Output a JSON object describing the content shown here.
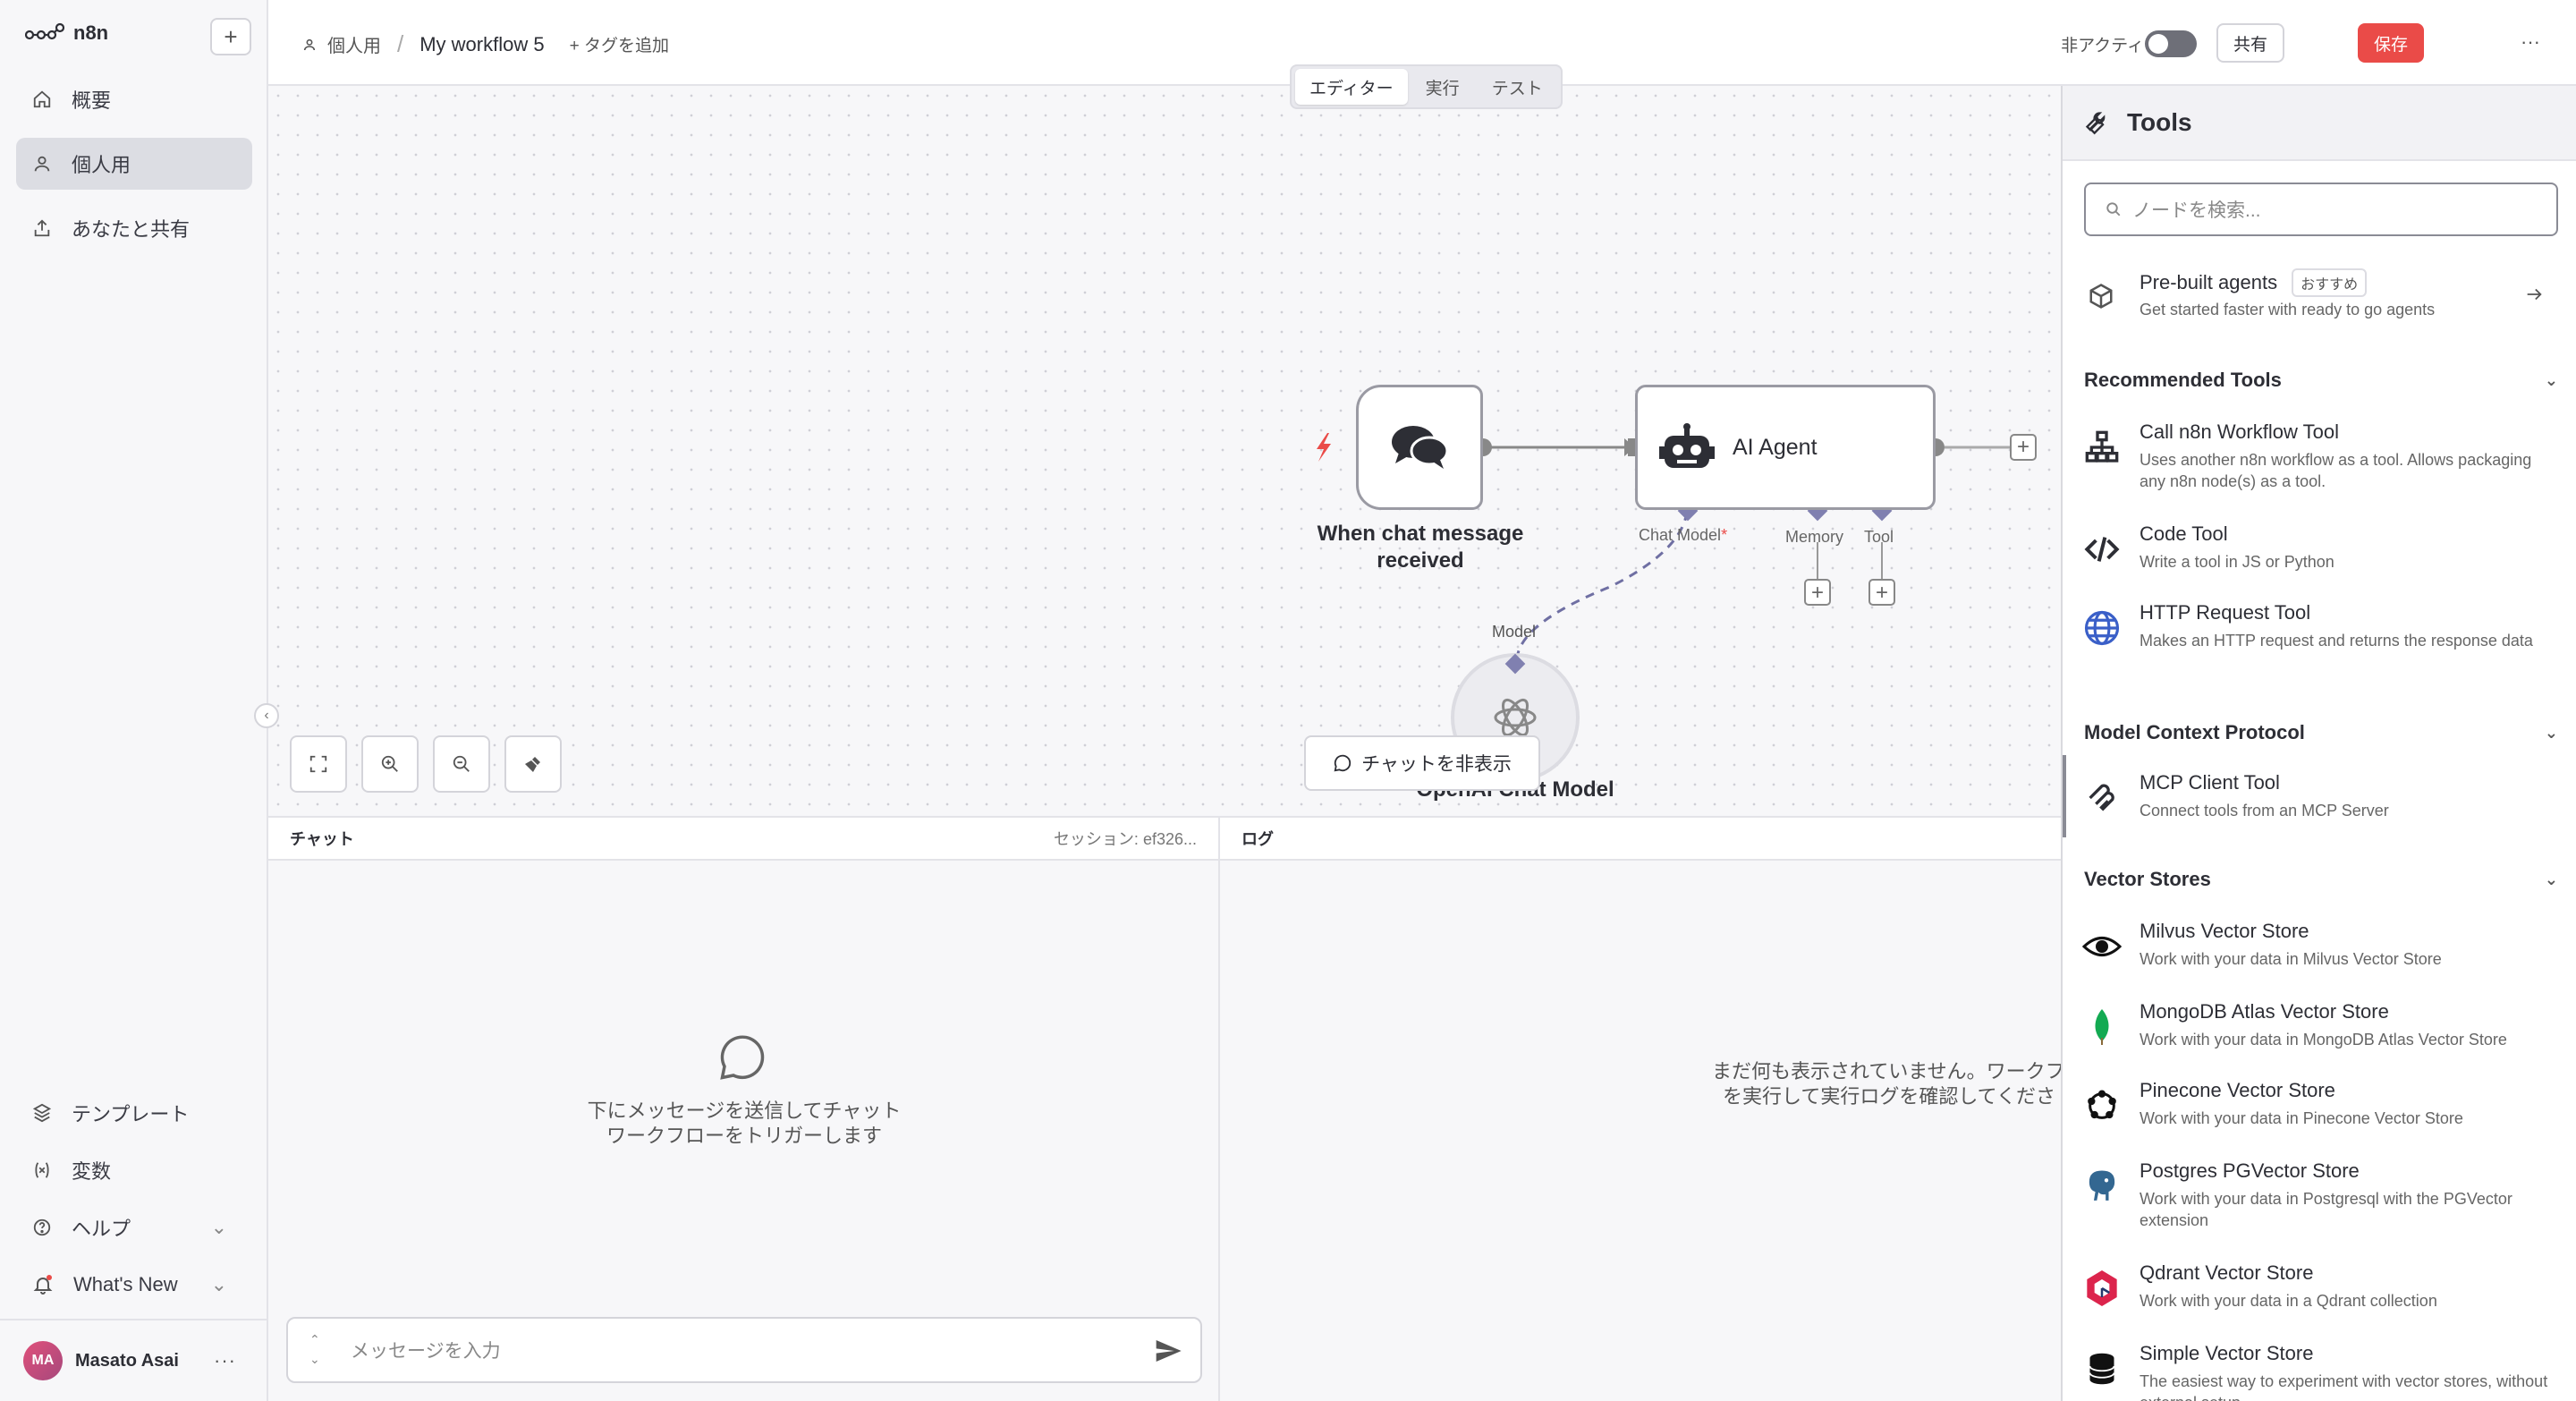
{
  "app": {
    "name": "n8n",
    "new_button": "+"
  },
  "sidebar": {
    "items": [
      {
        "label": "概要",
        "icon": "home-icon"
      },
      {
        "label": "個人用",
        "icon": "user-icon"
      },
      {
        "label": "あなたと共有",
        "icon": "share-icon"
      }
    ],
    "bottom": [
      {
        "label": "テンプレート",
        "icon": "templates-icon"
      },
      {
        "label": "変数",
        "icon": "variables-icon"
      },
      {
        "label": "ヘルプ",
        "icon": "help-icon"
      },
      {
        "label": "What's New",
        "icon": "bell-icon"
      }
    ],
    "user": {
      "initials": "MA",
      "name": "Masato Asai"
    }
  },
  "header": {
    "breadcrumb_project": "個人用",
    "workflow_name": "My workflow 5",
    "add_tag": "+ タグを追加",
    "inactive_label": "非アクティブ",
    "share": "共有",
    "save": "保存"
  },
  "tabs": [
    {
      "label": "エディター",
      "active": true
    },
    {
      "label": "実行",
      "active": false
    },
    {
      "label": "テスト",
      "active": false
    }
  ],
  "canvas": {
    "trigger_label_1": "When chat message",
    "trigger_label_2": "received",
    "agent_label": "AI Agent",
    "port_chat_model": "Chat Model",
    "port_memory": "Memory",
    "port_tool": "Tool",
    "port_model": "Model",
    "openai_label": "OpenAI Chat Model",
    "hide_chat": "チャットを非表示"
  },
  "chat": {
    "title": "チャット",
    "session": "セッション: ef326...",
    "empty_1": "下にメッセージを送信してチャット",
    "empty_2": "ワークフローをトリガーします",
    "input_placeholder": "メッセージを入力"
  },
  "log": {
    "title": "ログ",
    "empty_1": "まだ何も表示されていません。ワークフロ",
    "empty_2": "を実行して実行ログを確認してくださ"
  },
  "tools_panel": {
    "title": "Tools",
    "search_placeholder": "ノードを検索...",
    "prebuilt_title": "Pre-built agents",
    "prebuilt_badge": "おすすめ",
    "prebuilt_desc": "Get started faster with ready to go agents",
    "sections": {
      "recommended": "Recommended Tools",
      "mcp": "Model Context Protocol",
      "vector": "Vector Stores"
    },
    "recommended": [
      {
        "name": "Call n8n Workflow Tool",
        "desc": "Uses another n8n workflow as a tool. Allows packaging any n8n node(s) as a tool.",
        "icon": "sitemap-icon"
      },
      {
        "name": "Code Tool",
        "desc": "Write a tool in JS or Python",
        "icon": "code-icon"
      },
      {
        "name": "HTTP Request Tool",
        "desc": "Makes an HTTP request and returns the response data",
        "icon": "globe-icon"
      }
    ],
    "mcp": [
      {
        "name": "MCP Client Tool",
        "desc": "Connect tools from an MCP Server",
        "icon": "mcp-icon"
      }
    ],
    "vector": [
      {
        "name": "Milvus Vector Store",
        "desc": "Work with your data in Milvus Vector Store",
        "icon": "milvus-icon"
      },
      {
        "name": "MongoDB Atlas Vector Store",
        "desc": "Work with your data in MongoDB Atlas Vector Store",
        "icon": "mongodb-icon"
      },
      {
        "name": "Pinecone Vector Store",
        "desc": "Work with your data in Pinecone Vector Store",
        "icon": "pinecone-icon"
      },
      {
        "name": "Postgres PGVector Store",
        "desc": "Work with your data in Postgresql with the PGVector extension",
        "icon": "postgres-icon"
      },
      {
        "name": "Qdrant Vector Store",
        "desc": "Work with your data in a Qdrant collection",
        "icon": "qdrant-icon"
      },
      {
        "name": "Simple Vector Store",
        "desc": "The easiest way to experiment with vector stores, without external setup.",
        "icon": "database-icon"
      }
    ]
  }
}
